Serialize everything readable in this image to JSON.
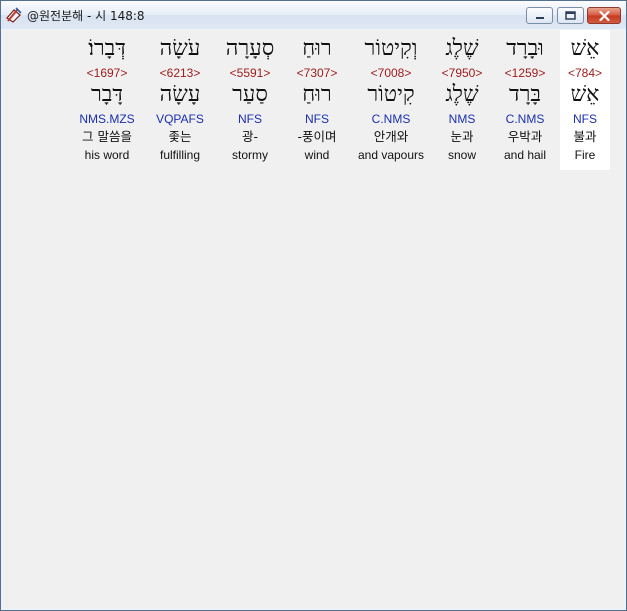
{
  "window": {
    "title": "@원전분해 - 시 148:8",
    "app_icon": "book-pencil-icon",
    "controls": {
      "minimize": "minimize-icon",
      "maximize": "maximize-icon",
      "close": "close-icon"
    },
    "colors": {
      "strong": "#9e1a1a",
      "morph": "#1a2fb0",
      "selected_bg": "#ffffff"
    }
  },
  "words": [
    {
      "hebrew": "דְּבָרוֹ׃",
      "strong": "<1697>",
      "lemma": "דָּבָר",
      "morph": "NMS.MZS",
      "korean": "그 말씀을",
      "english": "his word"
    },
    {
      "hebrew": "עֹשָׂה",
      "strong": "<6213>",
      "lemma": "עָשָׂה",
      "morph": "VQPAFS",
      "korean": "좇는",
      "english": "fulfilling"
    },
    {
      "hebrew": "סְעָרָה",
      "strong": "<5591>",
      "lemma": "סַעַר",
      "morph": "NFS",
      "korean": "광-",
      "english": "stormy"
    },
    {
      "hebrew": "רוּחַ",
      "strong": "<7307>",
      "lemma": "רוּחַ",
      "morph": "NFS",
      "korean": "-풍이며",
      "english": "wind"
    },
    {
      "hebrew": "וְקִיטוֹר",
      "strong": "<7008>",
      "lemma": "קִיטוֹר",
      "morph": "C.NMS",
      "korean": "안개와",
      "english": "and vapours"
    },
    {
      "hebrew": "שֶׁלֶג",
      "strong": "<7950>",
      "lemma": "שֶׁלֶג",
      "morph": "NMS",
      "korean": "눈과",
      "english": "snow"
    },
    {
      "hebrew": "וּבָרָד",
      "strong": "<1259>",
      "lemma": "בָּרָד",
      "morph": "C.NMS",
      "korean": "우박과",
      "english": "and hail"
    },
    {
      "hebrew": "אֵשׁ",
      "strong": "<784>",
      "lemma": "אֵשׁ",
      "morph": "NFS",
      "korean": "불과",
      "english": "Fire"
    }
  ]
}
